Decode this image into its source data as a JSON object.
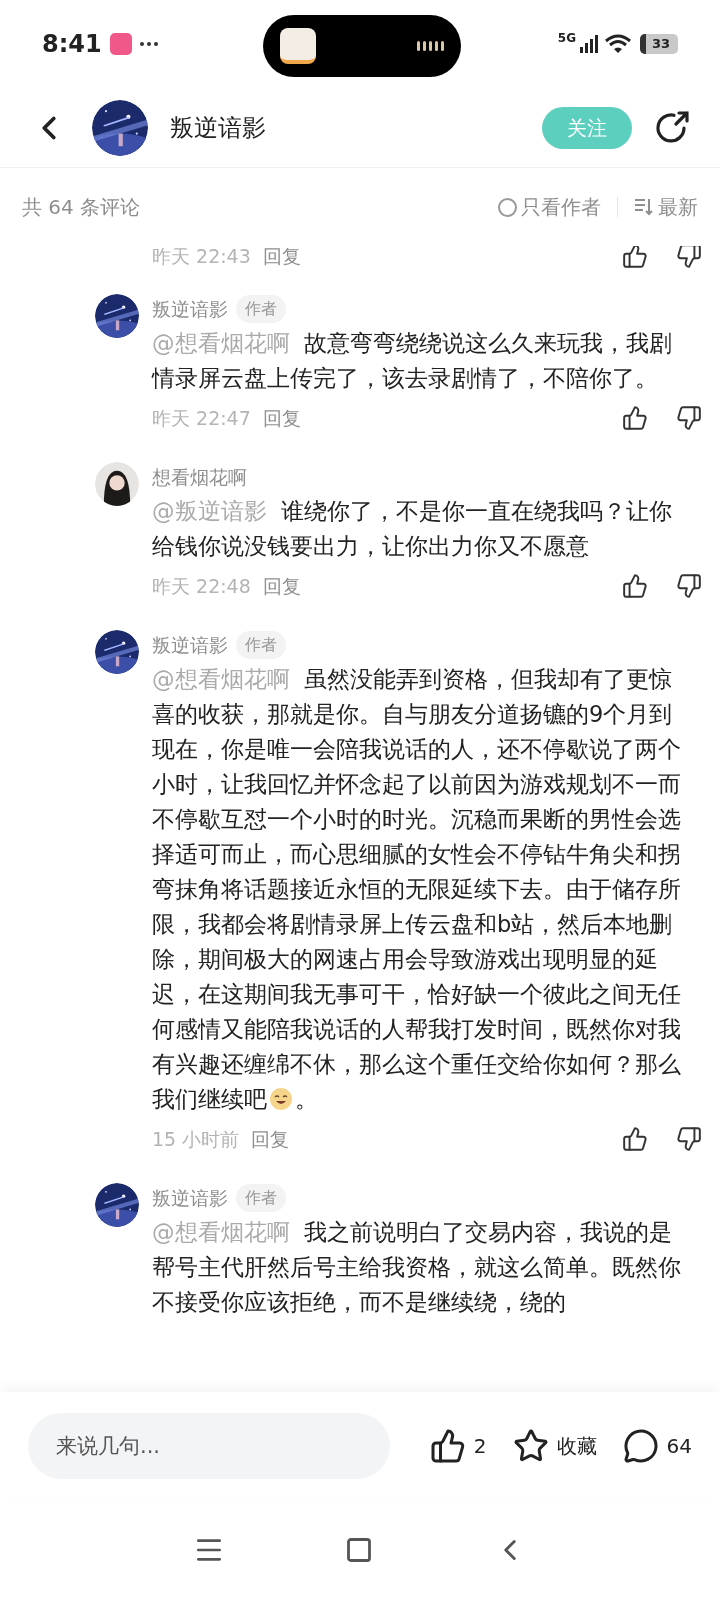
{
  "status_bar": {
    "time": "8:41",
    "network": "5G",
    "battery": "33"
  },
  "header": {
    "title": "叛逆谙影",
    "follow": "关注"
  },
  "filter": {
    "count": "共 64 条评论",
    "author_only": {
      "label": "只看作者",
      "checked": false
    },
    "sort": "最新"
  },
  "partial_meta": {
    "time": "昨天 22:43",
    "reply": "回复"
  },
  "comments": [
    {
      "kind": "author",
      "user": "叛逆谙影",
      "badge": "作者",
      "mention": "@想看烟花啊",
      "text": "故意弯弯绕绕说这么久来玩我，我剧情录屏云盘上传完了，该去录剧情了，不陪你了。",
      "time": "昨天 22:47",
      "reply": "回复"
    },
    {
      "kind": "user",
      "user": "想看烟花啊",
      "mention": "@叛逆谙影",
      "text": "谁绕你了，不是你一直在绕我吗？让你给钱你说没钱要出力，让你出力你又不愿意",
      "time": "昨天 22:48",
      "reply": "回复"
    },
    {
      "kind": "author",
      "user": "叛逆谙影",
      "badge": "作者",
      "mention": "@想看烟花啊",
      "text": "虽然没能弄到资格，但我却有了更惊喜的收获，那就是你。自与朋友分道扬镳的9个月到现在，你是唯一会陪我说话的人，还不停歇说了两个小时，让我回忆并怀念起了以前因为游戏规划不一而不停歇互怼一个小时的时光。沉稳而果断的男性会选择适可而止，而心思细腻的女性会不停钻牛角尖和拐弯抹角将话题接近永恒的无限延续下去。由于储存所限，我都会将剧情录屏上传云盘和b站，然后本地删除，期间极大的网速占用会导致游戏出现明显的延迟，在这期间我无事可干，恰好缺一个彼此之间无任何感情又能陪我说话的人帮我打发时间，既然你对我有兴趣还缠绵不休，那么这个重任交给你如何？那么我们继续吧",
      "sticker": true,
      "tail": "。",
      "time": "15 小时前",
      "reply": "回复"
    },
    {
      "kind": "author",
      "user": "叛逆谙影",
      "badge": "作者",
      "mention": "@想看烟花啊",
      "text": "我之前说明白了交易内容，我说的是帮号主代肝然后号主给我资格，就这么简单。既然你不接受你应该拒绝，而不是继续绕，绕的"
    }
  ],
  "bottom_bar": {
    "placeholder": "来说几句...",
    "likes": "2",
    "favorite": "收藏",
    "comments": "64"
  }
}
